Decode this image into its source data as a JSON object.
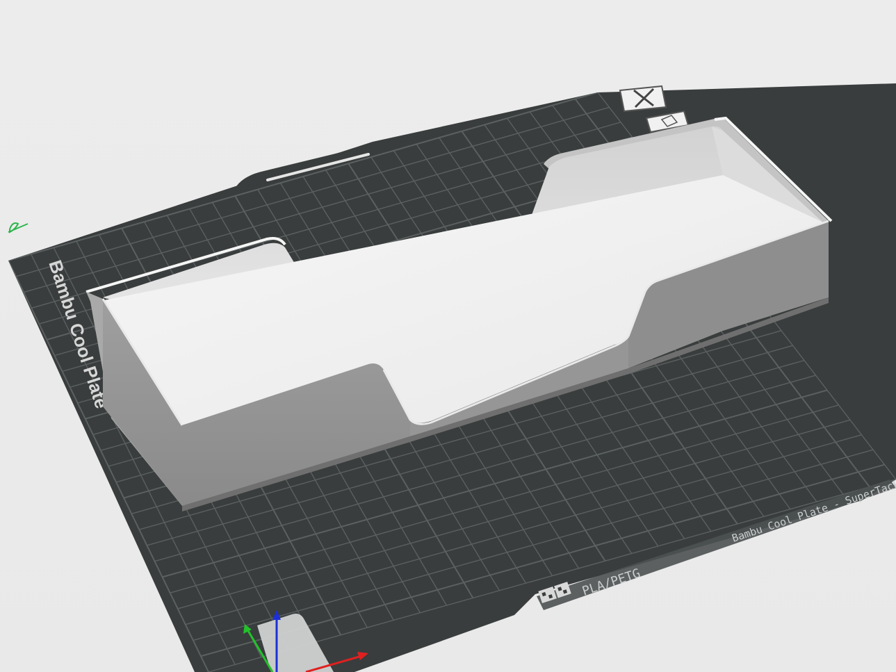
{
  "plate": {
    "side_brand": "Bambu Cool Plate",
    "front_label": "Bambu Cool Plate - SuperTack",
    "filament_label": "PLA/PETG",
    "grid_divisions": 26
  },
  "colors": {
    "background": "#ebebeb",
    "plate": "#3a3d3d",
    "grid": "#5b6061",
    "model_light": "#f3f3f3",
    "model_mid": "#c6c6c6",
    "model_dark": "#8f8f8f",
    "axis_x": "#e02020",
    "axis_y": "#22c22a",
    "axis_z": "#1c2fd6",
    "edit_icon": "#2eb54c"
  },
  "overlay_icons": [
    {
      "name": "delete-plate-icon"
    },
    {
      "name": "arrange-plate-icon"
    },
    {
      "name": "edit-plate-name-icon"
    }
  ]
}
